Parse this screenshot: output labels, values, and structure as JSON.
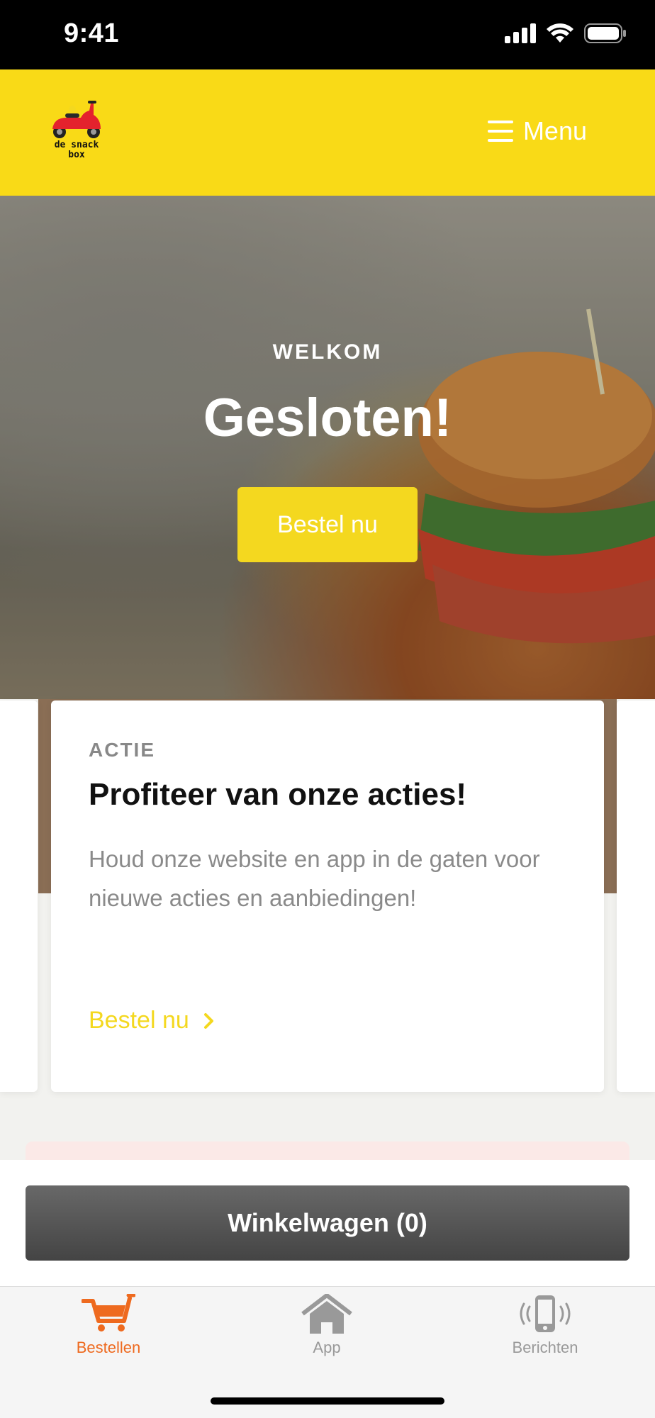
{
  "status_bar": {
    "time": "9:41"
  },
  "header": {
    "logo_text": "de snack box",
    "menu_label": "Menu"
  },
  "hero": {
    "subtitle": "WELKOM",
    "title": "Gesloten!",
    "button_label": "Bestel nu"
  },
  "promo_card": {
    "label": "ACTIE",
    "title": "Profiteer van onze acties!",
    "text": "Houd onze website en app in de gaten voor nieuwe acties en aanbiedingen!",
    "link_label": "Bestel nu"
  },
  "cart": {
    "button_label": "Winkelwagen (0)"
  },
  "tab_bar": {
    "items": [
      {
        "label": "Bestellen",
        "icon": "cart-icon",
        "active": true
      },
      {
        "label": "App",
        "icon": "home-icon",
        "active": false
      },
      {
        "label": "Berichten",
        "icon": "phone-ring-icon",
        "active": false
      }
    ]
  },
  "colors": {
    "brand_yellow": "#f9da17",
    "accent_orange": "#ee6a1f",
    "cart_gray": "#555555"
  }
}
